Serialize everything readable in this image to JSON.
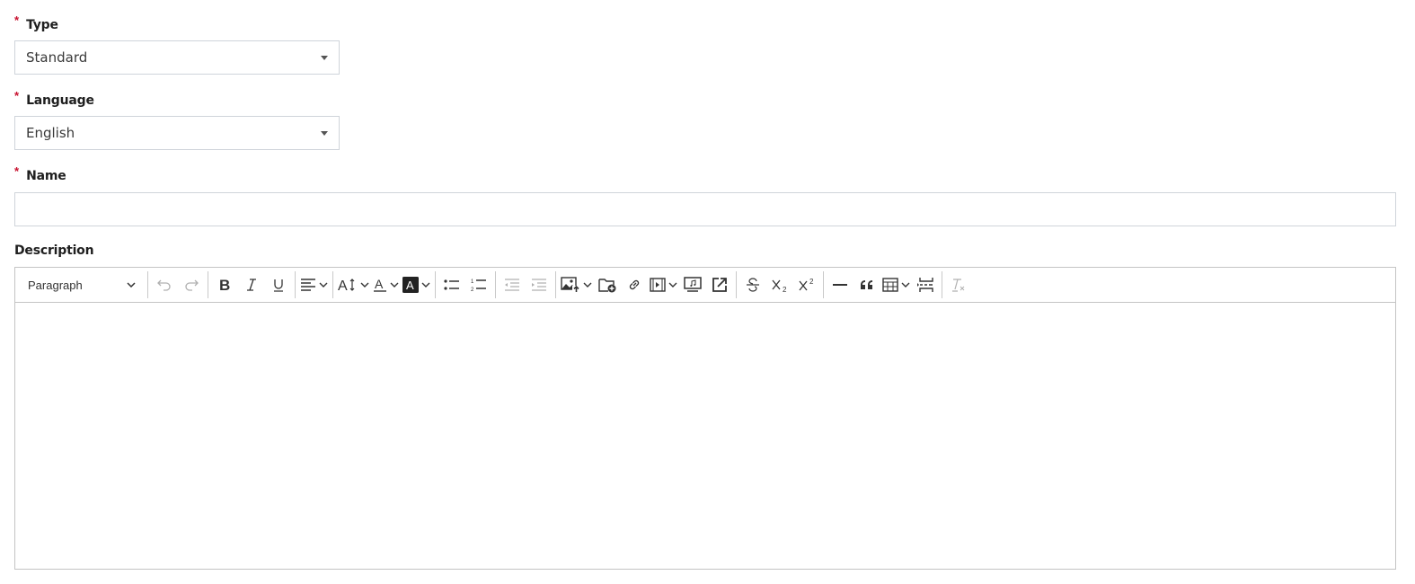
{
  "form": {
    "type": {
      "label": "Type",
      "required_mark": "*",
      "value": "Standard"
    },
    "language": {
      "label": "Language",
      "required_mark": "*",
      "value": "English"
    },
    "name": {
      "label": "Name",
      "required_mark": "*",
      "value": "",
      "placeholder": ""
    },
    "description": {
      "label": "Description"
    }
  },
  "editor": {
    "heading_select": "Paragraph",
    "toolbar_tools": [
      "undo",
      "redo",
      "bold",
      "italic",
      "underline",
      "alignment",
      "font-size",
      "font-color",
      "font-background-color",
      "bulleted-list",
      "numbered-list",
      "outdent",
      "indent",
      "image-upload",
      "file-manager",
      "link",
      "media-embed",
      "html-embed",
      "open-external",
      "strikethrough",
      "subscript",
      "superscript",
      "horizontal-line",
      "block-quote",
      "insert-table",
      "page-break",
      "remove-format"
    ],
    "content": ""
  },
  "colors": {
    "required": "#c8102e",
    "border": "#cfd4da",
    "editor_border": "#c4c4c4",
    "icon": "#333333",
    "icon_disabled": "#b0b0b0"
  }
}
